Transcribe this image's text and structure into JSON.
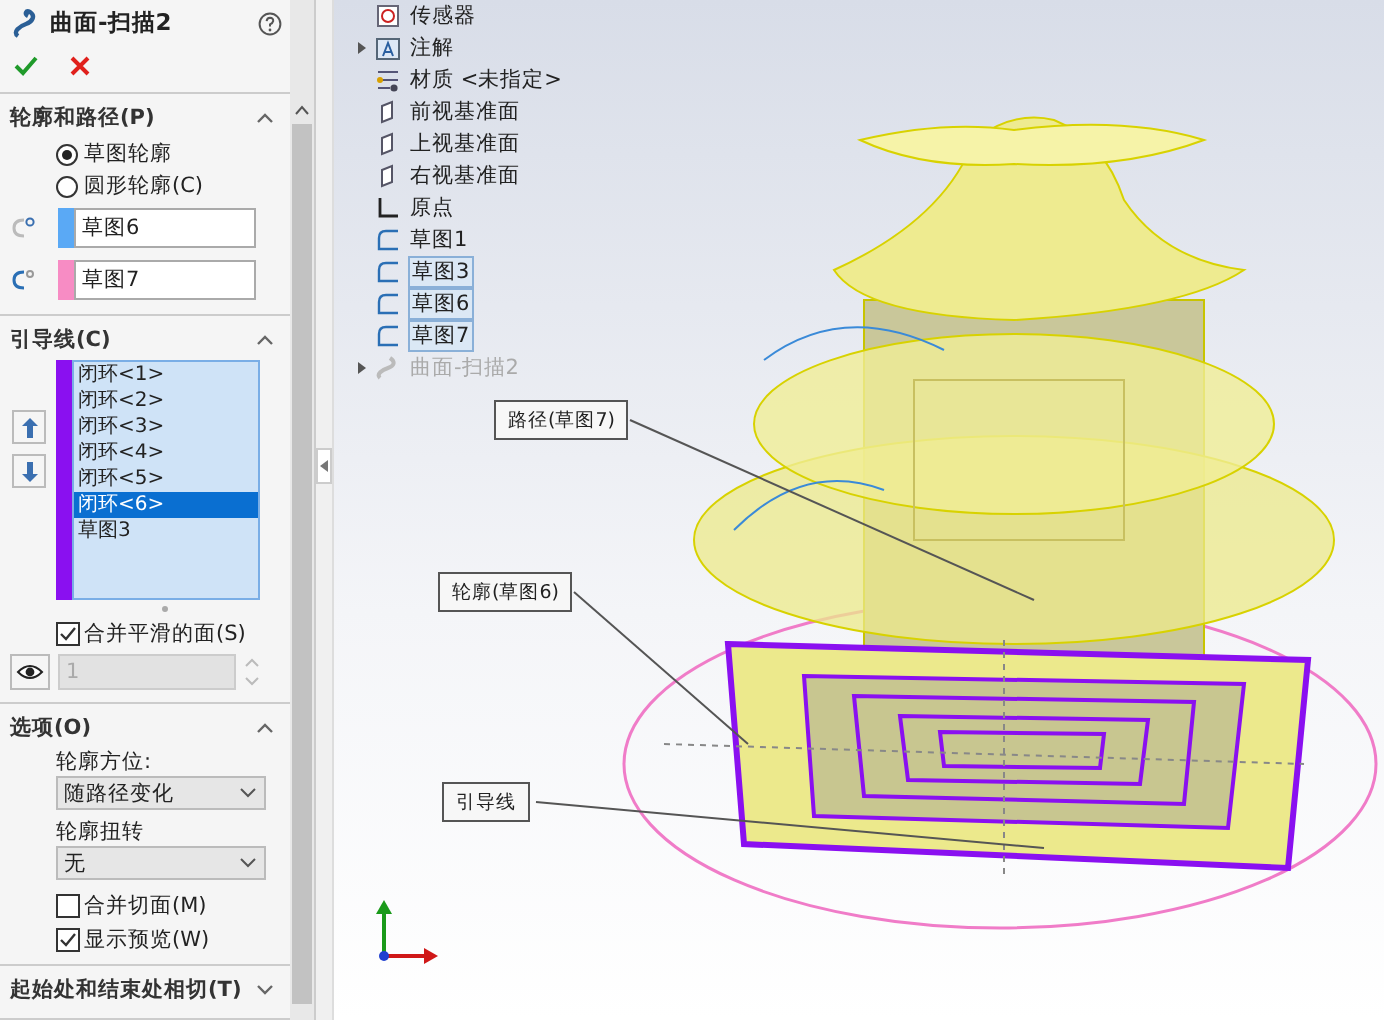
{
  "feature_title": "曲面-扫描2",
  "profile_path": {
    "heading": "轮廓和路径(P)",
    "expanded": true,
    "options": [
      {
        "label": "草图轮廓",
        "selected": true
      },
      {
        "label": "圆形轮廓(C)",
        "selected": false
      }
    ],
    "fields": [
      {
        "kind": "profile",
        "value": "草图6",
        "color": "#5aa9f5"
      },
      {
        "kind": "path",
        "value": "草图7",
        "color": "#f78cc4"
      }
    ]
  },
  "guides": {
    "heading": "引导线(C)",
    "expanded": true,
    "color": "#8a10f0",
    "items": [
      {
        "label": "闭环<1>",
        "selected": false
      },
      {
        "label": "闭环<2>",
        "selected": false
      },
      {
        "label": "闭环<3>",
        "selected": false
      },
      {
        "label": "闭环<4>",
        "selected": false
      },
      {
        "label": "闭环<5>",
        "selected": false
      },
      {
        "label": "闭环<6>",
        "selected": true
      },
      {
        "label": "草图3",
        "selected": false
      }
    ],
    "merge_smooth": {
      "label": "合并平滑的面(S)",
      "checked": true
    },
    "count": "1"
  },
  "options": {
    "heading": "选项(O)",
    "expanded": true,
    "dropdowns": [
      {
        "label": "轮廓方位:",
        "value": "随路径变化"
      },
      {
        "label": "轮廓扭转",
        "value": "无"
      }
    ],
    "checkboxes": [
      {
        "label": "合并切面(M)",
        "checked": false
      },
      {
        "label": "显示预览(W)",
        "checked": true
      }
    ]
  },
  "tangency": {
    "heading": "起始处和结束处相切(T)",
    "expanded": false
  },
  "tree": [
    {
      "label": "传感器",
      "kind": "sensor",
      "has_children": false,
      "selected": false,
      "disabled": false
    },
    {
      "label": "注解",
      "kind": "annotation",
      "has_children": true,
      "selected": false,
      "disabled": false
    },
    {
      "label": "材质 <未指定>",
      "kind": "material",
      "has_children": false,
      "selected": false,
      "disabled": false
    },
    {
      "label": "前视基准面",
      "kind": "plane",
      "has_children": false,
      "selected": false,
      "disabled": false
    },
    {
      "label": "上视基准面",
      "kind": "plane",
      "has_children": false,
      "selected": false,
      "disabled": false
    },
    {
      "label": "右视基准面",
      "kind": "plane",
      "has_children": false,
      "selected": false,
      "disabled": false
    },
    {
      "label": "原点",
      "kind": "origin",
      "has_children": false,
      "selected": false,
      "disabled": false
    },
    {
      "label": "草图1",
      "kind": "sketch",
      "has_children": false,
      "selected": false,
      "disabled": false
    },
    {
      "label": "草图3",
      "kind": "sketch",
      "has_children": false,
      "selected": true,
      "disabled": false
    },
    {
      "label": "草图6",
      "kind": "sketch",
      "has_children": false,
      "selected": true,
      "disabled": false
    },
    {
      "label": "草图7",
      "kind": "sketch",
      "has_children": false,
      "selected": true,
      "disabled": false
    },
    {
      "label": "曲面-扫描2",
      "kind": "sweep",
      "has_children": true,
      "selected": false,
      "disabled": true
    }
  ],
  "callouts": [
    {
      "label": "路径(草图7)"
    },
    {
      "label": "轮廓(草图6)"
    },
    {
      "label": "引导线"
    }
  ]
}
